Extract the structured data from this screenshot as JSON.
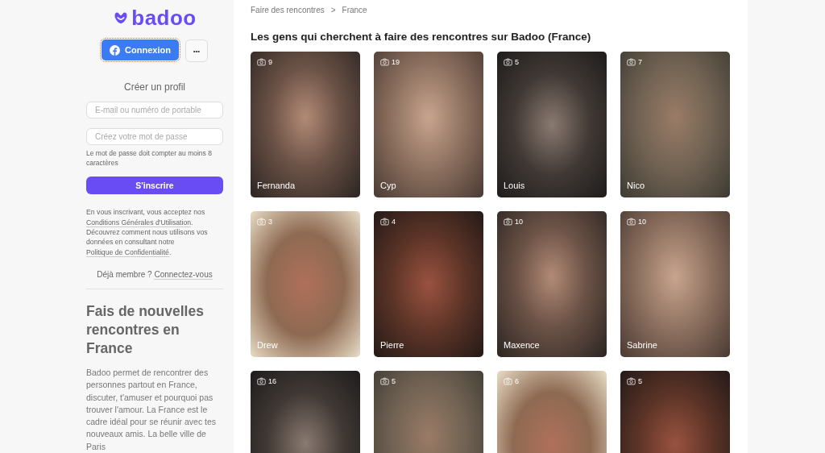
{
  "logo": "badoo",
  "login_button": "Connexion",
  "more_button": "•••",
  "create_profile": "Créer un profil",
  "email_field": {
    "placeholder": "E-mail ou numéro de portable"
  },
  "password_field": {
    "placeholder": "Créez votre mot de passe"
  },
  "password_hint": "Le mot de passe doit compter au moins 8 caractères",
  "signup_button": "S'inscrire",
  "terms": [
    {
      "kind": "text",
      "text": "En vous inscrivant, vous acceptez nos"
    },
    {
      "kind": "link",
      "text": "Conditions Générales d'Utilisation"
    },
    {
      "kind": "text",
      "text": ". Découvrez comment nous utilisons vos données en consultant notre"
    },
    {
      "kind": "link",
      "text": "Politique de Confidentialité"
    },
    {
      "kind": "text",
      "text": "."
    }
  ],
  "member_prompt": {
    "text": "Déjà membre ?",
    "link": "Connectez-vous"
  },
  "seo_title": "Fais de nouvelles rencontres en France",
  "seo_text": "Badoo permet de rencontrer des personnes partout en France, discuter, t'amuser et pourquoi pas trouver l'amour. La France est le cadre idéal pour se réunir avec tes nouveaux amis. La belle ville de Paris",
  "breadcrumb": [
    "Faire des rencontres",
    "France"
  ],
  "breadcrumb_separator": ">",
  "heading": "Les gens qui cherchent à faire des rencontres sur Badoo (France)",
  "profiles": [
    {
      "photos": "9",
      "name": "Fernanda"
    },
    {
      "photos": "19",
      "name": "Cyp"
    },
    {
      "photos": "5",
      "name": "Louis"
    },
    {
      "photos": "7",
      "name": "Nico"
    },
    {
      "photos": "3",
      "name": "Drew"
    },
    {
      "photos": "4",
      "name": "Pierre"
    },
    {
      "photos": "10",
      "name": "Maxence"
    },
    {
      "photos": "10",
      "name": "Sabrine"
    },
    {
      "photos": "16"
    },
    {
      "photos": "5"
    },
    {
      "photos": "6"
    },
    {
      "photos": "5"
    }
  ]
}
